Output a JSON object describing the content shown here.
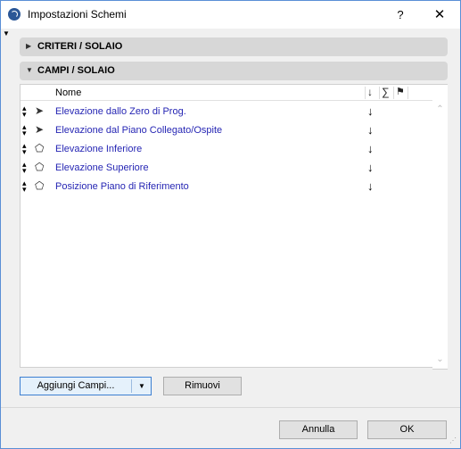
{
  "window": {
    "title": "Impostazioni Schemi",
    "help_label": "?",
    "close_label": "✕"
  },
  "sections": {
    "criteri": {
      "label": "CRITERI /  SOLAIO",
      "expanded": false
    },
    "campi": {
      "label": "CAMPI / SOLAIO",
      "expanded": true
    }
  },
  "table": {
    "column_header": "Nome",
    "header_icons": [
      "sort-descending-icon",
      "sum-icon",
      "flag-icon"
    ],
    "rows": [
      {
        "label": "Elevazione dallo Zero di Prog.",
        "icon": "pointer-icon",
        "sort": "↓"
      },
      {
        "label": "Elevazione dal Piano Collegato/Ospite",
        "icon": "pointer-icon",
        "sort": "↓"
      },
      {
        "label": "Elevazione Inferiore",
        "icon": "slab-outline-icon",
        "sort": "↓"
      },
      {
        "label": "Elevazione Superiore",
        "icon": "slab-outline-icon",
        "sort": "↓"
      },
      {
        "label": "Posizione Piano di Riferimento",
        "icon": "slab-outline-icon",
        "sort": "↓"
      }
    ]
  },
  "buttons": {
    "add_fields": "Aggiungi Campi...",
    "remove": "Rimuovi",
    "cancel": "Annulla",
    "ok": "OK"
  },
  "colors": {
    "link_text": "#2626b4",
    "accent_border": "#3c7fd1",
    "window_border": "#5a8fd6"
  }
}
